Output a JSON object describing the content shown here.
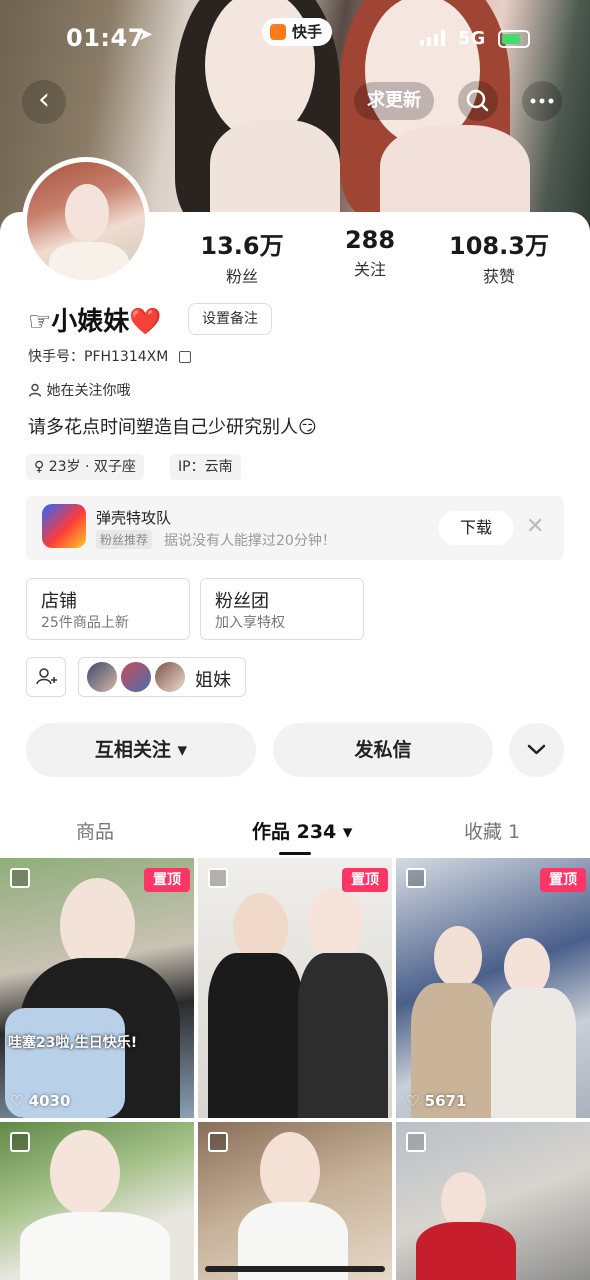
{
  "status_bar": {
    "time": "01:47",
    "network": "5G"
  },
  "header": {
    "app_badge": "快手",
    "update_button": "求更新"
  },
  "profile": {
    "stats": [
      {
        "value": "13.6万",
        "label": "粉丝"
      },
      {
        "value": "288",
        "label": "关注"
      },
      {
        "value": "108.3万",
        "label": "获赞"
      }
    ],
    "name": "☞小婊妹❤️",
    "remark_button": "设置备注",
    "kuaishou_id": "快手号：PFH1314XM",
    "follow_status": "她在关注你哦",
    "bio": "请多花点时间塑造自己少研究别人😏",
    "tags": [
      "♀ 23岁 · 双子座",
      "IP：云南"
    ]
  },
  "promo": {
    "app_name": "弹壳特攻队",
    "chip": "粉丝推荐",
    "description": "据说没有人能撑过20分钟！",
    "download_button": "下载"
  },
  "shortcuts": [
    {
      "title": "店铺",
      "subtitle": "25件商品上新"
    },
    {
      "title": "粉丝团",
      "subtitle": "加入享特权"
    }
  ],
  "friends": {
    "label": "姐妹"
  },
  "actions": {
    "follow": "互相关注 ▾",
    "message": "发私信"
  },
  "tabs": [
    {
      "label": "商品",
      "active": false
    },
    {
      "label": "作品 234 ▾",
      "active": true
    },
    {
      "label": "收藏 1",
      "active": false
    }
  ],
  "posts": [
    {
      "pinned_label": "置顶",
      "likes": "4030",
      "caption": "哇塞23啦,生日快乐!"
    },
    {
      "pinned_label": "置顶",
      "likes": ""
    },
    {
      "pinned_label": "置顶",
      "likes": "5671"
    },
    {
      "pinned_label": "",
      "likes": ""
    },
    {
      "pinned_label": "",
      "likes": ""
    },
    {
      "pinned_label": "",
      "likes": ""
    }
  ],
  "colors": {
    "accent": "#fe3666",
    "brand": "#ff7a1a"
  }
}
